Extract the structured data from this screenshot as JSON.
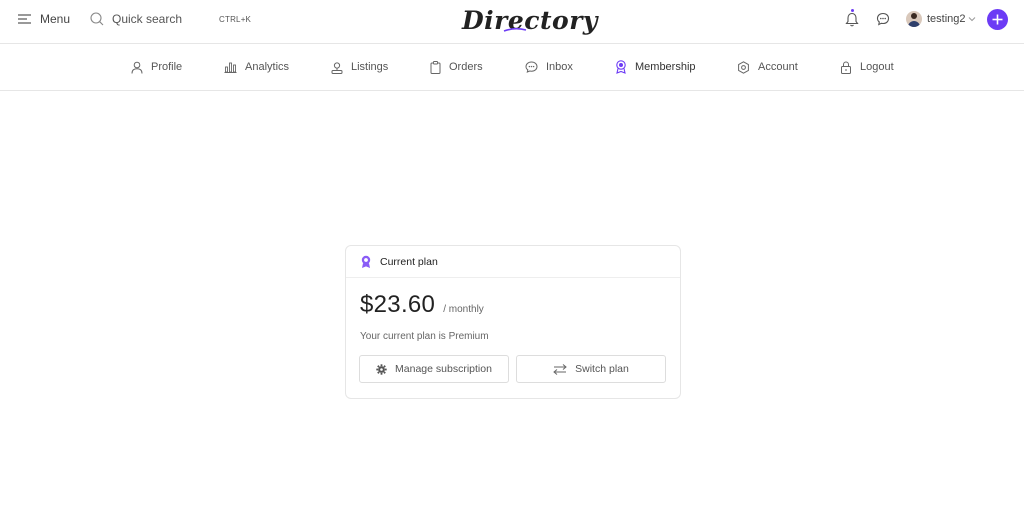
{
  "header": {
    "menu_label": "Menu",
    "search_label": "Quick search",
    "shortcut": "CTRL+K",
    "logo_text": "Directory",
    "username": "testing2"
  },
  "nav": {
    "items": [
      {
        "label": "Profile",
        "icon": "user-icon"
      },
      {
        "label": "Analytics",
        "icon": "bar-chart-icon"
      },
      {
        "label": "Listings",
        "icon": "listing-icon"
      },
      {
        "label": "Orders",
        "icon": "clipboard-icon"
      },
      {
        "label": "Inbox",
        "icon": "chat-icon"
      },
      {
        "label": "Membership",
        "icon": "badge-icon"
      },
      {
        "label": "Account",
        "icon": "gear-icon"
      },
      {
        "label": "Logout",
        "icon": "lock-icon"
      }
    ],
    "active": "Membership"
  },
  "plan": {
    "title": "Current plan",
    "price": "$23.60",
    "period": "/ monthly",
    "description": "Your current plan is Premium",
    "manage_label": "Manage subscription",
    "switch_label": "Switch plan"
  },
  "colors": {
    "accent": "#6c3bf5"
  }
}
